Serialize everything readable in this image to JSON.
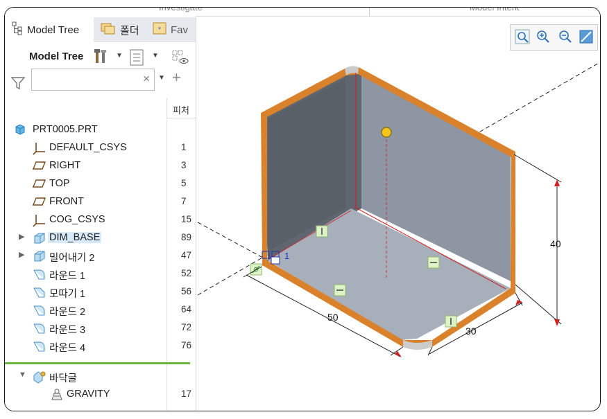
{
  "ribbon": {
    "tab_left": "Investigate",
    "tab_right": "Model Intent"
  },
  "tabs": [
    {
      "label": "Model Tree",
      "icon": "model-tree-icon"
    },
    {
      "label": "폴더",
      "icon": "folder-browser-icon"
    },
    {
      "label": "Fav",
      "icon": "favorites-icon"
    }
  ],
  "toolbar": {
    "label": "Model Tree",
    "icons": [
      "settings-tools-icon",
      "show-columns-icon",
      "layer-visibility-icon"
    ]
  },
  "search": {
    "value": "",
    "placeholder": ""
  },
  "columns": {
    "feature_id": "피처"
  },
  "tree": [
    {
      "label": "PRT0005.PRT",
      "value": "",
      "icon": "part-icon",
      "expandable": false
    },
    {
      "label": "DEFAULT_CSYS",
      "value": "1",
      "icon": "csys-icon",
      "expandable": false
    },
    {
      "label": "RIGHT",
      "value": "3",
      "icon": "datum-plane-icon",
      "expandable": false
    },
    {
      "label": "TOP",
      "value": "5",
      "icon": "datum-plane-icon",
      "expandable": false
    },
    {
      "label": "FRONT",
      "value": "7",
      "icon": "datum-plane-icon",
      "expandable": false
    },
    {
      "label": "COG_CSYS",
      "value": "15",
      "icon": "csys-icon",
      "expandable": false
    },
    {
      "label": "DIM_BASE",
      "value": "89",
      "icon": "extrude-icon",
      "expandable": true,
      "highlighted": true
    },
    {
      "label": "밀어내기 2",
      "value": "47",
      "icon": "extrude-icon",
      "expandable": true
    },
    {
      "label": "라운드 1",
      "value": "52",
      "icon": "round-icon",
      "expandable": false
    },
    {
      "label": "모따기 1",
      "value": "56",
      "icon": "chamfer-icon",
      "expandable": false
    },
    {
      "label": "라운드 2",
      "value": "64",
      "icon": "round-icon",
      "expandable": false
    },
    {
      "label": "라운드 3",
      "value": "72",
      "icon": "round-icon",
      "expandable": false
    },
    {
      "label": "라운드 4",
      "value": "76",
      "icon": "round-icon",
      "expandable": false
    }
  ],
  "sub_tree": [
    {
      "label": "바닥글",
      "value": "",
      "icon": "footer-folder-icon",
      "expandable": true,
      "expanded": true
    },
    {
      "label": "GRAVITY",
      "value": "17",
      "icon": "gravity-analysis-icon",
      "expandable": false
    }
  ],
  "view_toolbar": [
    "refit-icon",
    "zoom-in-icon",
    "zoom-out-icon",
    "repaint-icon"
  ],
  "dimensions": {
    "height": "40",
    "width": "50",
    "depth": "30",
    "csys_label": "1"
  },
  "colors": {
    "accent": "#d9822b",
    "part_face": "#9aa3b0",
    "highlight": "#d7eaf9",
    "divider": "#6db33f"
  }
}
